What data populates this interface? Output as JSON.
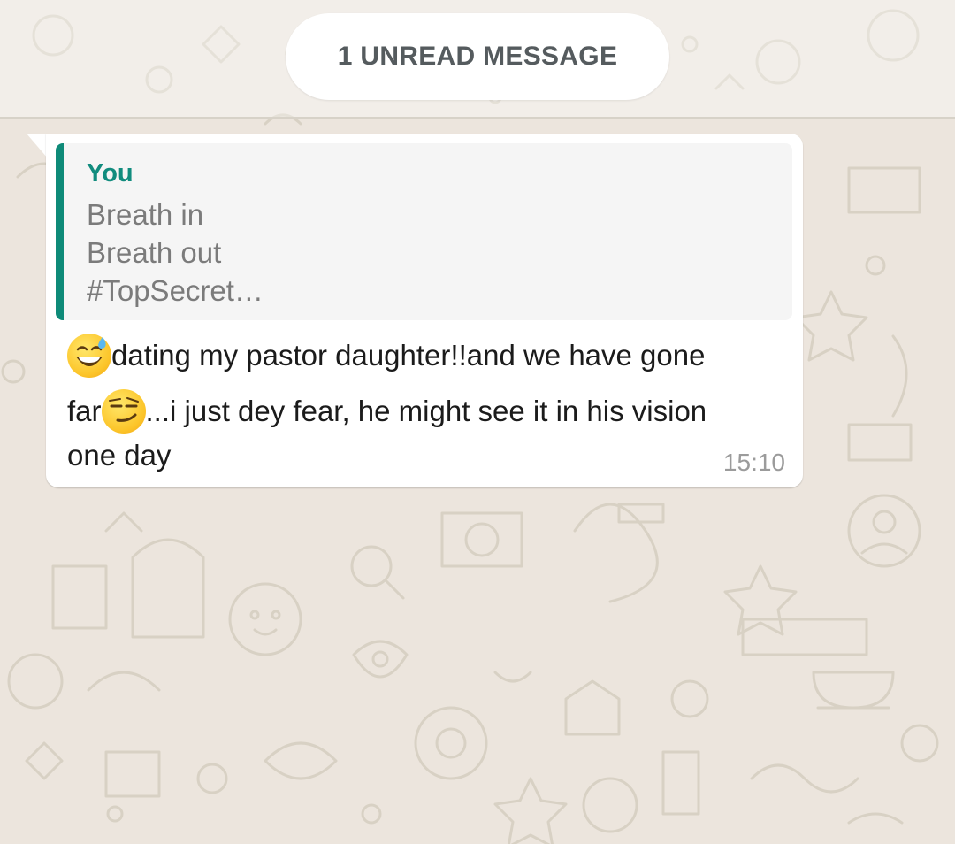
{
  "divider": {
    "label": "1 UNREAD MESSAGE"
  },
  "message": {
    "quoted": {
      "author": "You",
      "lines": [
        "Breath in",
        "Breath out",
        "#TopSecret…"
      ]
    },
    "text_line_1": "dating my pastor daughter!!and we have gone",
    "text_line_2_start": "far",
    "text_line_2_end": "...i just dey fear, he might see it in his vision",
    "text_line_3": "one day",
    "emoji_1": "grinning-sweat-emoji",
    "emoji_2": "smirking-face-emoji",
    "time": "15:10"
  },
  "colors": {
    "background": "#ece5dd",
    "bubble": "#ffffff",
    "quote_accent": "#0e8a78",
    "quote_author": "#118c7e"
  }
}
